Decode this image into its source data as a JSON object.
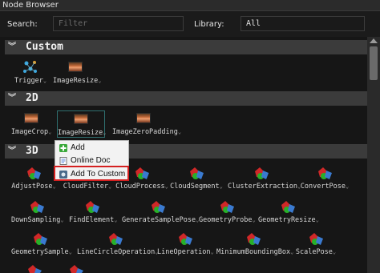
{
  "window": {
    "title": "Node Browser"
  },
  "filter": {
    "search_label": "Search:",
    "search_placeholder": "Filter",
    "library_label": "Library:",
    "library_value": "All"
  },
  "categories": [
    {
      "name": "Custom",
      "nodes": [
        "Trigger",
        "ImageResize"
      ]
    },
    {
      "name": "2D",
      "nodes": [
        "ImageCrop",
        "ImageResize",
        "ImageZeroPadding"
      ]
    },
    {
      "name": "3D",
      "nodes": [
        "AdjustPose",
        "CloudFilter",
        "CloudProcess",
        "CloudSegment",
        "ClusterExtraction",
        "ConvertPose",
        "DownSampling",
        "FindElement",
        "GenerateSamplePose",
        "GeometryProbe",
        "GeometryResize",
        "GeometrySample",
        "LineCircleOperation",
        "LineOperation",
        "MinimumBoundingBox",
        "ScalePose"
      ]
    }
  ],
  "context_menu": {
    "items": [
      {
        "label": "Add",
        "icon": "add-icon"
      },
      {
        "label": "Online Doc",
        "icon": "doc-icon"
      },
      {
        "label": "Add To Custom",
        "icon": "custom-icon"
      }
    ],
    "highlighted": "Add To Custom"
  },
  "colors": {
    "highlight_border": "#d42020",
    "selection_border": "#2f6f6f",
    "category_header": "#3b3b3b"
  }
}
